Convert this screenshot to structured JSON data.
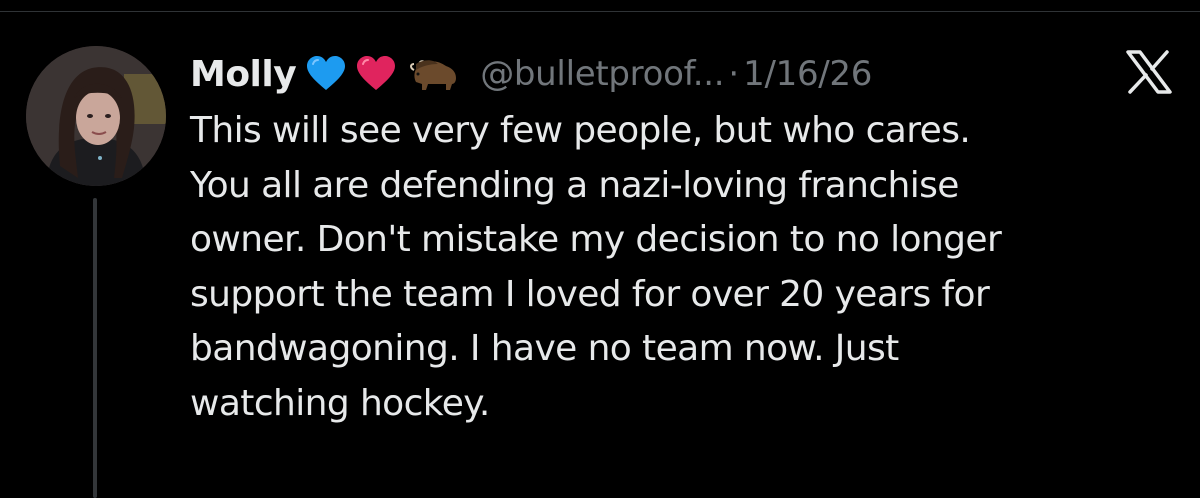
{
  "tweet": {
    "display_name": "Molly",
    "emojis": [
      "blue-heart-icon",
      "red-heart-icon",
      "bison-icon"
    ],
    "handle": "@bulletproof...",
    "separator": "·",
    "date": "1/16/26",
    "text_lines": [
      "This will see very few people, but who cares.",
      "You all are defending a nazi-loving franchise",
      "owner. Don't mistake my decision to no longer",
      "support the team I loved for over 20 years for",
      "bandwagoning. I have no team now. Just",
      "watching hockey."
    ]
  },
  "colors": {
    "background": "#000000",
    "primary_text": "#e7e9ea",
    "secondary_text": "#71767b",
    "thread_line": "#333639",
    "blue_heart": "#1d9bf0",
    "red_heart": "#e0245e"
  }
}
